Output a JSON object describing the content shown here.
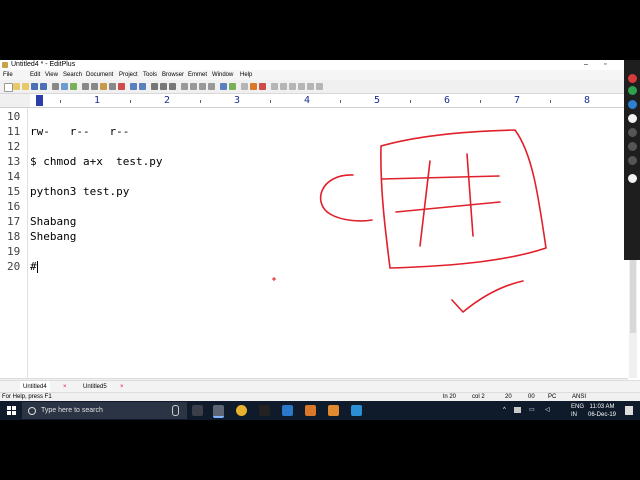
{
  "window": {
    "title": "Untitled4 * - EditPlus"
  },
  "menu": [
    "File",
    "Edit",
    "View",
    "Search",
    "Document",
    "Project",
    "Tools",
    "Browser",
    "Emmet",
    "Window",
    "Help"
  ],
  "ruler": [
    "1",
    "2",
    "3",
    "4",
    "5",
    "6",
    "7",
    "8"
  ],
  "lines": [
    {
      "num": "10",
      "text": ""
    },
    {
      "num": "11",
      "text": "rw-   r--   r--"
    },
    {
      "num": "12",
      "text": ""
    },
    {
      "num": "13",
      "text": "$ chmod a+x  test.py"
    },
    {
      "num": "14",
      "text": ""
    },
    {
      "num": "15",
      "text": "python3 test.py"
    },
    {
      "num": "16",
      "text": ""
    },
    {
      "num": "17",
      "text": "Shabang"
    },
    {
      "num": "18",
      "text": "Shebang"
    },
    {
      "num": "19",
      "text": ""
    },
    {
      "num": "20",
      "text": "#"
    }
  ],
  "tabs": [
    "Untitled4",
    "Untitled5"
  ],
  "status": {
    "help": "For Help, press F1",
    "line": "ln 20",
    "col": "col 2",
    "n1": "20",
    "n2": "00",
    "eol": "PC",
    "encoding": "ANSI"
  },
  "taskbar": {
    "search_placeholder": "Type here to search",
    "lang_top": "ENG",
    "lang_bottom": "IN",
    "time": "11:03 AM",
    "date": "06-Dec-19"
  },
  "colors": {
    "pen": "#e0202a",
    "ruler_numbers": "#1b2f8f",
    "taskbar": "#0f1a2b"
  }
}
